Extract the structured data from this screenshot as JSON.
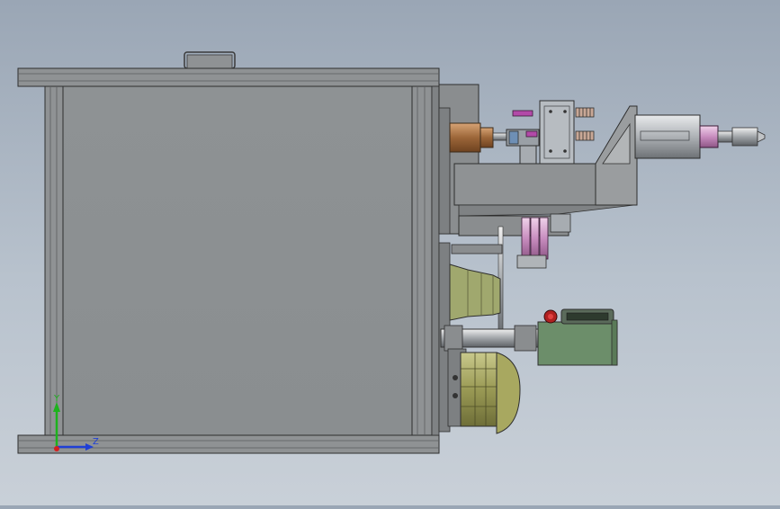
{
  "viewport": {
    "background_top": "#9aa6b5",
    "background_bottom": "#c9d0d8"
  },
  "triad": {
    "y_label": "Y",
    "z_label": "Z",
    "y_color": "#1db31d",
    "z_color": "#1f3fd6",
    "x_color": "#d42020"
  },
  "colors": {
    "frame": "#8f9294",
    "panel": "#8d9193",
    "copper": "#b07a4a",
    "magenta": "#b24aa8",
    "pink_rod": "#d8a9cf",
    "green_block": "#6c8e6a",
    "yellow_drum": "#a8a860",
    "red_knob": "#b02020"
  }
}
